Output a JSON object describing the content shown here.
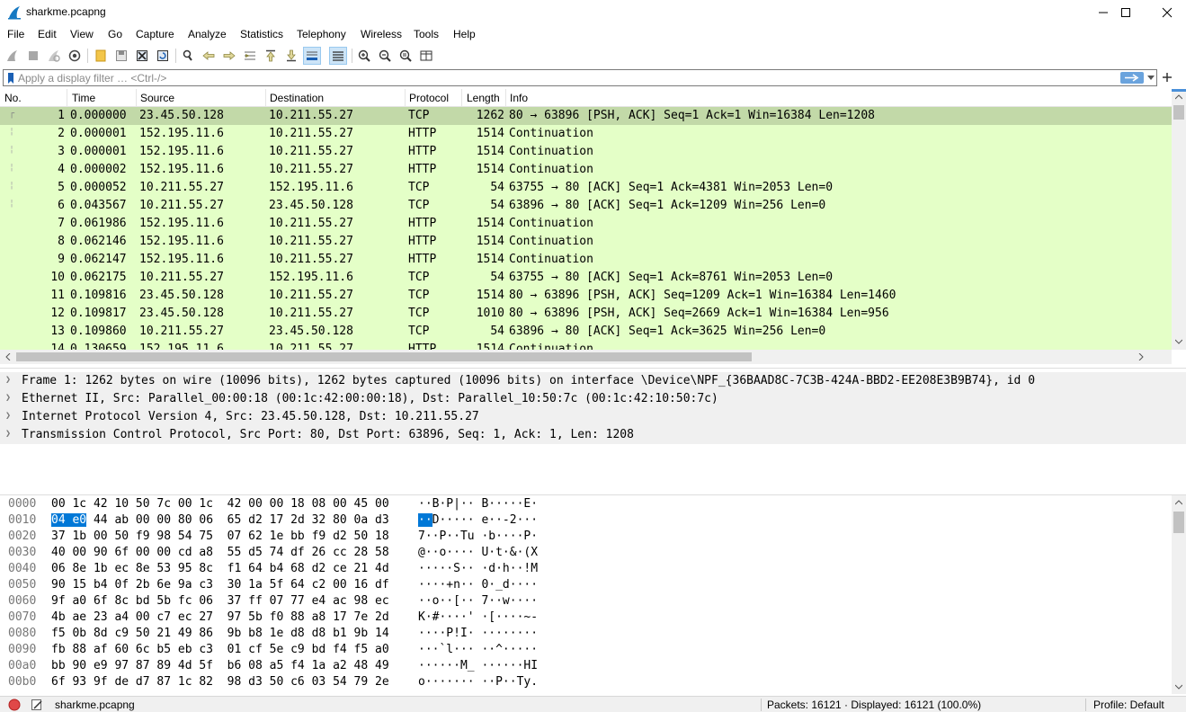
{
  "window": {
    "title": "sharkme.pcapng",
    "minimize_glyph": "—",
    "maximize_glyph": "☐",
    "close_glyph": "✕"
  },
  "menu": [
    "File",
    "Edit",
    "View",
    "Go",
    "Capture",
    "Analyze",
    "Statistics",
    "Telephony",
    "Wireless",
    "Tools",
    "Help"
  ],
  "toolbar_icons": [
    "start-capture-icon",
    "stop-capture-icon",
    "restart-capture-icon",
    "capture-options-icon",
    "open-file-icon",
    "save-file-icon",
    "close-file-icon",
    "reload-file-icon",
    "find-packet-icon",
    "go-back-icon",
    "go-forward-icon",
    "go-to-packet-icon",
    "go-first-packet-icon",
    "go-last-packet-icon",
    "auto-scroll-icon",
    "colorize-icon",
    "zoom-in-icon",
    "zoom-out-icon",
    "normal-size-icon",
    "resize-columns-icon"
  ],
  "filter": {
    "placeholder": "Apply a display filter … <Ctrl-/>",
    "value": ""
  },
  "packet_list": {
    "columns": [
      "No.",
      "Time",
      "Source",
      "Destination",
      "Protocol",
      "Length",
      "Info"
    ],
    "rows": [
      {
        "no": "1",
        "time": "0.000000",
        "src": "23.45.50.128",
        "dst": "10.211.55.27",
        "proto": "TCP",
        "len": "1262",
        "info": "80 → 63896 [PSH, ACK] Seq=1 Ack=1 Win=16384 Len=1208",
        "selected": true
      },
      {
        "no": "2",
        "time": "0.000001",
        "src": "152.195.11.6",
        "dst": "10.211.55.27",
        "proto": "HTTP",
        "len": "1514",
        "info": "Continuation"
      },
      {
        "no": "3",
        "time": "0.000001",
        "src": "152.195.11.6",
        "dst": "10.211.55.27",
        "proto": "HTTP",
        "len": "1514",
        "info": "Continuation"
      },
      {
        "no": "4",
        "time": "0.000002",
        "src": "152.195.11.6",
        "dst": "10.211.55.27",
        "proto": "HTTP",
        "len": "1514",
        "info": "Continuation"
      },
      {
        "no": "5",
        "time": "0.000052",
        "src": "10.211.55.27",
        "dst": "152.195.11.6",
        "proto": "TCP",
        "len": "54",
        "info": "63755 → 80 [ACK] Seq=1 Ack=4381 Win=2053 Len=0"
      },
      {
        "no": "6",
        "time": "0.043567",
        "src": "10.211.55.27",
        "dst": "23.45.50.128",
        "proto": "TCP",
        "len": "54",
        "info": "63896 → 80 [ACK] Seq=1 Ack=1209 Win=256 Len=0"
      },
      {
        "no": "7",
        "time": "0.061986",
        "src": "152.195.11.6",
        "dst": "10.211.55.27",
        "proto": "HTTP",
        "len": "1514",
        "info": "Continuation"
      },
      {
        "no": "8",
        "time": "0.062146",
        "src": "152.195.11.6",
        "dst": "10.211.55.27",
        "proto": "HTTP",
        "len": "1514",
        "info": "Continuation"
      },
      {
        "no": "9",
        "time": "0.062147",
        "src": "152.195.11.6",
        "dst": "10.211.55.27",
        "proto": "HTTP",
        "len": "1514",
        "info": "Continuation"
      },
      {
        "no": "10",
        "time": "0.062175",
        "src": "10.211.55.27",
        "dst": "152.195.11.6",
        "proto": "TCP",
        "len": "54",
        "info": "63755 → 80 [ACK] Seq=1 Ack=8761 Win=2053 Len=0"
      },
      {
        "no": "11",
        "time": "0.109816",
        "src": "23.45.50.128",
        "dst": "10.211.55.27",
        "proto": "TCP",
        "len": "1514",
        "info": "80 → 63896 [PSH, ACK] Seq=1209 Ack=1 Win=16384 Len=1460"
      },
      {
        "no": "12",
        "time": "0.109817",
        "src": "23.45.50.128",
        "dst": "10.211.55.27",
        "proto": "TCP",
        "len": "1010",
        "info": "80 → 63896 [PSH, ACK] Seq=2669 Ack=1 Win=16384 Len=956"
      },
      {
        "no": "13",
        "time": "0.109860",
        "src": "10.211.55.27",
        "dst": "23.45.50.128",
        "proto": "TCP",
        "len": "54",
        "info": "63896 → 80 [ACK] Seq=1 Ack=3625 Win=256 Len=0"
      },
      {
        "no": "14",
        "time": "0.130659",
        "src": "152.195.11.6",
        "dst": "10.211.55.27",
        "proto": "HTTP",
        "len": "1514",
        "info": "Continuation"
      }
    ]
  },
  "details": [
    "Frame 1: 1262 bytes on wire (10096 bits), 1262 bytes captured (10096 bits) on interface \\Device\\NPF_{36BAAD8C-7C3B-424A-BBD2-EE208E3B9B74}, id 0",
    "Ethernet II, Src: Parallel_00:00:18 (00:1c:42:00:00:18), Dst: Parallel_10:50:7c (00:1c:42:10:50:7c)",
    "Internet Protocol Version 4, Src: 23.45.50.128, Dst: 10.211.55.27",
    "Transmission Control Protocol, Src Port: 80, Dst Port: 63896, Seq: 1, Ack: 1, Len: 1208"
  ],
  "hex": [
    {
      "off": "0000",
      "bytes": "00 1c 42 10 50 7c 00 1c  42 00 00 18 08 00 45 00",
      "ascii": "··B·P|·· B·····E·"
    },
    {
      "off": "0010",
      "bytes_hl": "04 e0",
      "bytes": " 44 ab 00 00 80 06  65 d2 17 2d 32 80 0a d3",
      "ascii_hl": "··",
      "ascii": "D····· e··-2···"
    },
    {
      "off": "0020",
      "bytes": "37 1b 00 50 f9 98 54 75  07 62 1e bb f9 d2 50 18",
      "ascii": "7··P··Tu ·b····P·"
    },
    {
      "off": "0030",
      "bytes": "40 00 90 6f 00 00 cd a8  55 d5 74 df 26 cc 28 58",
      "ascii": "@··o···· U·t·&·(X"
    },
    {
      "off": "0040",
      "bytes": "06 8e 1b ec 8e 53 95 8c  f1 64 b4 68 d2 ce 21 4d",
      "ascii": "·····S·· ·d·h··!M"
    },
    {
      "off": "0050",
      "bytes": "90 15 b4 0f 2b 6e 9a c3  30 1a 5f 64 c2 00 16 df",
      "ascii": "····+n·· 0·_d····"
    },
    {
      "off": "0060",
      "bytes": "9f a0 6f 8c bd 5b fc 06  37 ff 07 77 e4 ac 98 ec",
      "ascii": "··o··[·· 7··w····"
    },
    {
      "off": "0070",
      "bytes": "4b ae 23 a4 00 c7 ec 27  97 5b f0 88 a8 17 7e 2d",
      "ascii": "K·#····' ·[····~-"
    },
    {
      "off": "0080",
      "bytes": "f5 0b 8d c9 50 21 49 86  9b b8 1e d8 d8 b1 9b 14",
      "ascii": "····P!I· ········"
    },
    {
      "off": "0090",
      "bytes": "fb 88 af 60 6c b5 eb c3  01 cf 5e c9 bd f4 f5 a0",
      "ascii": "···`l··· ··^·····"
    },
    {
      "off": "00a0",
      "bytes": "bb 90 e9 97 87 89 4d 5f  b6 08 a5 f4 1a a2 48 49",
      "ascii": "······M_ ······HI"
    },
    {
      "off": "00b0",
      "bytes": "6f 93 9f de d7 87 1c 82  98 d3 50 c6 03 54 79 2e",
      "ascii": "o······· ··P··Ty."
    }
  ],
  "status": {
    "file": "sharkme.pcapng",
    "packets": "Packets: 16121 · Displayed: 16121 (100.0%)",
    "profile": "Profile: Default"
  },
  "colors": {
    "row_bg": "#e4ffc7",
    "row_selected": "#c2d9a8",
    "highlight": "#0078d7"
  }
}
